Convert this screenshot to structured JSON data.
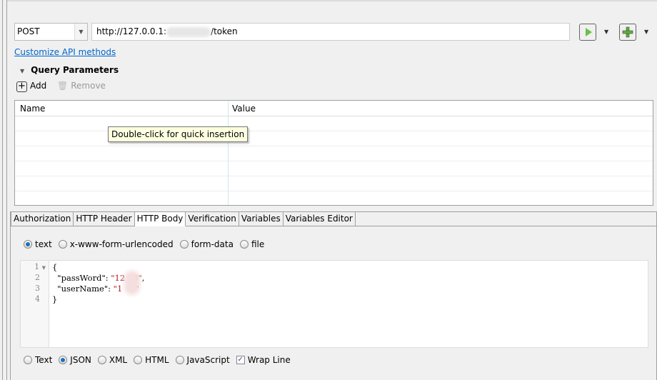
{
  "request": {
    "method": "POST",
    "url_prefix": "http://127.0.0.1:",
    "url_suffix": "/token"
  },
  "toolbar": {
    "run_icon": "play-icon",
    "add_icon": "plus-icon"
  },
  "customize_link": "Customize API methods",
  "query_parameters": {
    "title": "Query Parameters",
    "add_label": "Add",
    "remove_label": "Remove",
    "columns": [
      "Name",
      "Value"
    ],
    "tooltip": "Double-click for quick insertion"
  },
  "tabs": [
    "Authorization",
    "HTTP Header",
    "HTTP Body",
    "Verification",
    "Variables",
    "Variables Editor"
  ],
  "active_tab": "HTTP Body",
  "body_types": [
    "text",
    "x-www-form-urlencoded",
    "form-data",
    "file"
  ],
  "body_type_selected": "text",
  "editor": {
    "line_numbers": [
      "1",
      "2",
      "3",
      "4"
    ],
    "lines": [
      {
        "plain": "{"
      },
      {
        "key": "  \"passWord\": ",
        "val": "\"12   6\"",
        "tail": ","
      },
      {
        "key": "  \"userName\": ",
        "val": "\"1   1\"",
        "tail": ""
      },
      {
        "plain": "}"
      }
    ]
  },
  "formats": [
    "Text",
    "JSON",
    "XML",
    "HTML",
    "JavaScript"
  ],
  "format_selected": "JSON",
  "wrap_line": {
    "label": "Wrap Line",
    "checked": true
  },
  "colors": {
    "link": "#0066cc",
    "run_green": "#6cc04a",
    "string": "#b22222"
  }
}
